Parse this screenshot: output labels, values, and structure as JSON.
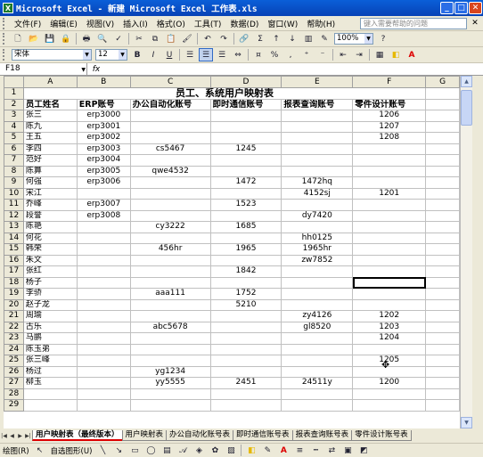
{
  "window": {
    "title": "Microsoft Excel - 新建 Microsoft Excel 工作表.xls"
  },
  "menu": {
    "items": [
      "文件(F)",
      "编辑(E)",
      "视图(V)",
      "插入(I)",
      "格式(O)",
      "工具(T)",
      "数据(D)",
      "窗口(W)",
      "帮助(H)"
    ],
    "help_placeholder": "键入需要帮助的问题"
  },
  "toolbar": {
    "zoom": "100%"
  },
  "format": {
    "font": "宋体",
    "size": "12",
    "bold": "B",
    "italic": "I",
    "underline": "U"
  },
  "formula": {
    "cell_ref": "F18",
    "fx": "fx",
    "content": ""
  },
  "columns": [
    "A",
    "B",
    "C",
    "D",
    "E",
    "F",
    "G"
  ],
  "sheet": {
    "title": "员工、系统用户映射表",
    "headers": [
      "员工姓名",
      "ERP账号",
      "办公自动化账号",
      "即时通信账号",
      "报表查询账号",
      "零件设计账号"
    ],
    "rows": [
      [
        "张三",
        "erp3000",
        "",
        "",
        "",
        "1206"
      ],
      [
        "陈九",
        "erp3001",
        "",
        "",
        "",
        "1207"
      ],
      [
        "王五",
        "erp3002",
        "",
        "",
        "",
        "1208"
      ],
      [
        "李四",
        "erp3003",
        "cs5467",
        "1245",
        "",
        ""
      ],
      [
        "范好",
        "erp3004",
        "",
        "",
        "",
        ""
      ],
      [
        "陈算",
        "erp3005",
        "qwe4532",
        "",
        "",
        ""
      ],
      [
        "何强",
        "erp3006",
        "",
        "1472",
        "1472hq",
        ""
      ],
      [
        "宋江",
        "",
        "",
        "",
        "4152sj",
        "1201"
      ],
      [
        "乔峰",
        "erp3007",
        "",
        "1523",
        "",
        ""
      ],
      [
        "段誉",
        "erp3008",
        "",
        "",
        "dy7420",
        ""
      ],
      [
        "陈艳",
        "",
        "cy3222",
        "1685",
        "",
        ""
      ],
      [
        "何花",
        "",
        "",
        "",
        "hh0125",
        ""
      ],
      [
        "韩荣",
        "",
        "456hr",
        "1965",
        "1965hr",
        ""
      ],
      [
        "朱文",
        "",
        "",
        "",
        "zw7852",
        ""
      ],
      [
        "张红",
        "",
        "",
        "1842",
        "",
        ""
      ],
      [
        "杨子",
        "",
        "",
        "",
        "",
        ""
      ],
      [
        "李骄",
        "",
        "aaa111",
        "1752",
        "",
        ""
      ],
      [
        "赵子龙",
        "",
        "",
        "5210",
        "",
        ""
      ],
      [
        "周瑜",
        "",
        "",
        "",
        "zy4126",
        "1202"
      ],
      [
        "古乐",
        "",
        "abc5678",
        "",
        "gl8520",
        "1203"
      ],
      [
        "马鹏",
        "",
        "",
        "",
        "",
        "1204"
      ],
      [
        "陈玉弟",
        "",
        "",
        "",
        "",
        ""
      ],
      [
        "张三峰",
        "",
        "",
        "",
        "",
        "1205"
      ],
      [
        "杨过",
        "",
        "yg1234",
        "",
        "",
        ""
      ],
      [
        "柳玉",
        "",
        "yy5555",
        "2451",
        "24511y",
        "1200"
      ]
    ],
    "row_numbers": [
      "1",
      "2",
      "3",
      "4",
      "5",
      "6",
      "7",
      "8",
      "9",
      "10",
      "11",
      "12",
      "13",
      "14",
      "15",
      "16",
      "17",
      "18",
      "19",
      "20",
      "21",
      "22",
      "23",
      "24",
      "25",
      "26",
      "27",
      "28",
      "29"
    ]
  },
  "tabs": [
    "用户映射表（最终版本）",
    "用户映射表",
    "办公自动化账号表",
    "即时通信账号表",
    "报表查询账号表",
    "零件设计账号表"
  ],
  "drawing": {
    "draw_label": "绘图(R)",
    "autoshapes_label": "自选图形(U)"
  }
}
